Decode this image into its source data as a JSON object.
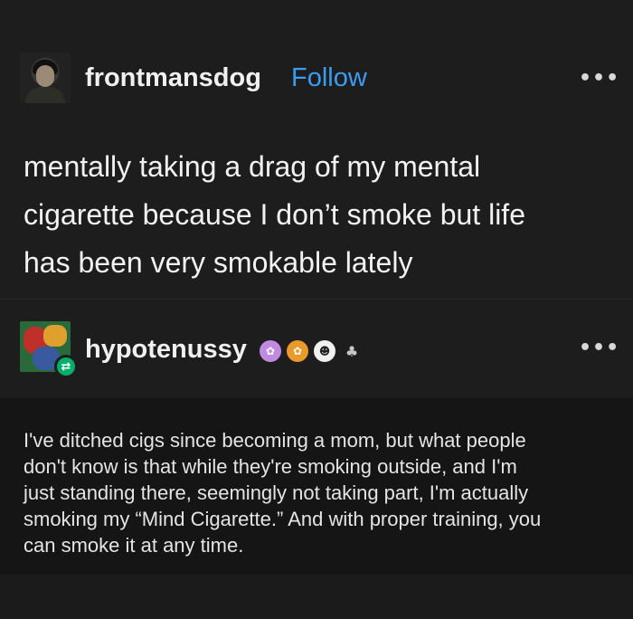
{
  "original_post": {
    "username": "frontmansdog",
    "follow_label": "Follow",
    "more_label": "•••",
    "avatar_icon": "user-avatar-photo",
    "text_lines": [
      "mentally taking a drag of my mental",
      "cigarette because I don’t smoke but life",
      "has been very smokable lately"
    ]
  },
  "reblog": {
    "username": "hypotenussy",
    "more_label": "•••",
    "avatar_icon": "user-avatar-art",
    "reblog_icon": "⇄",
    "badges": [
      {
        "icon": "paw-badge-icon",
        "glyph": "✿"
      },
      {
        "icon": "paw-badge-icon",
        "glyph": "✿"
      },
      {
        "icon": "face-badge-icon",
        "glyph": "☻"
      },
      {
        "icon": "sparkle-badge-icon",
        "glyph": "♣"
      }
    ],
    "text_lines": [
      "I've ditched cigs since becoming a mom, but what people",
      "don't know is that while they're smoking outside, and I'm",
      "just standing there, seemingly not taking part, I'm actually",
      "smoking my “Mind Cigarette.” And with proper training, you",
      "can smoke it at any time."
    ]
  },
  "colors": {
    "background": "#1b1b1b",
    "follow_link": "#3b9cf0",
    "reblog_badge": "#00b06a",
    "quote_panel": "#151515"
  }
}
